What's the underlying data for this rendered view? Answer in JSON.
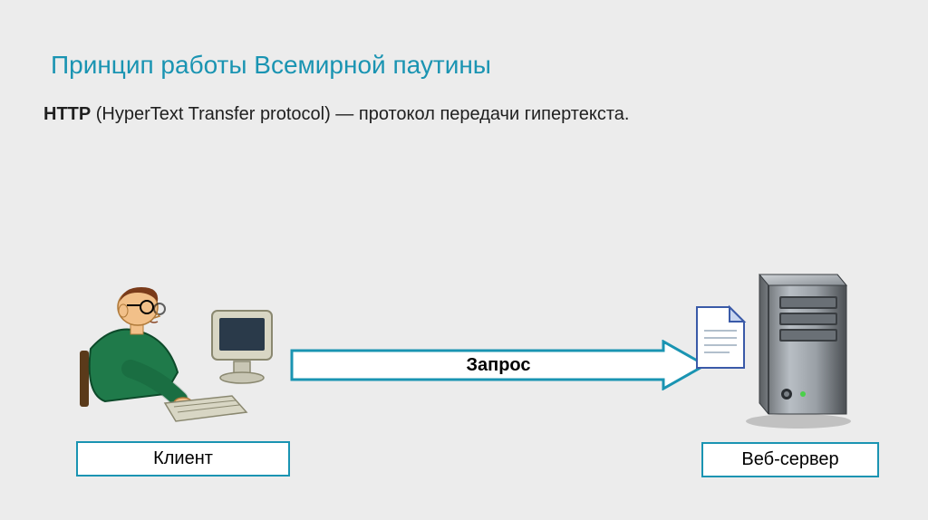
{
  "title": "Принцип работы Всемирной паутины",
  "subtitle_bold": "HTTP",
  "subtitle_rest": " (HyperText Transfer protocol) — протокол передачи гипертекста.",
  "diagram": {
    "arrow_label": "Запрос",
    "client_label": "Клиент",
    "server_label": "Веб-сервер"
  },
  "colors": {
    "accent": "#1a94b2"
  }
}
